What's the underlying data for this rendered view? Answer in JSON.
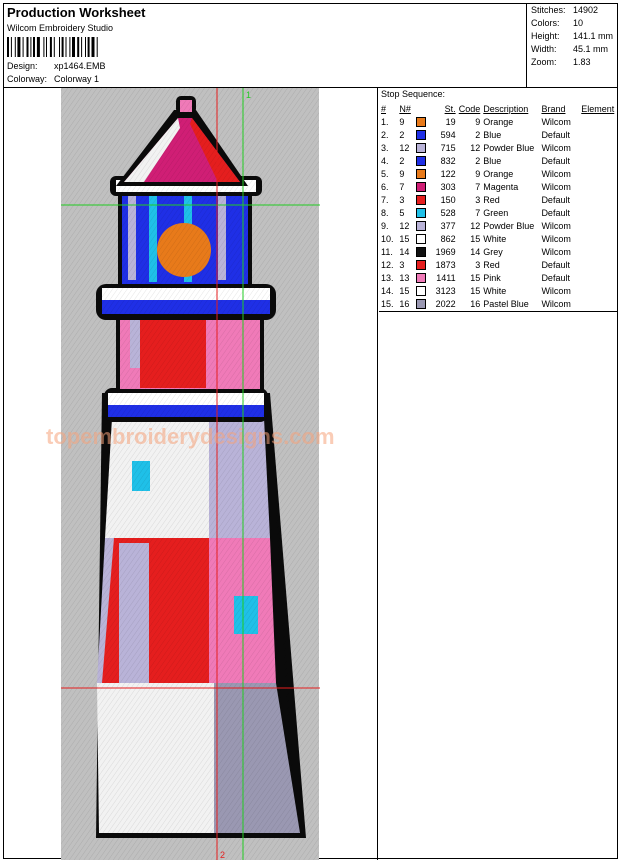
{
  "header": {
    "title": "Production Worksheet",
    "company": "Wilcom Embroidery Studio",
    "design_label": "Design:",
    "design_value": "xp1464.EMB",
    "colorway_label": "Colorway:",
    "colorway_value": "Colorway 1"
  },
  "stats": [
    {
      "label": "Stitches:",
      "value": "14902"
    },
    {
      "label": "Colors:",
      "value": "10"
    },
    {
      "label": "Height:",
      "value": "141.1 mm"
    },
    {
      "label": "Width:",
      "value": "45.1 mm"
    },
    {
      "label": "Zoom:",
      "value": "1.83"
    }
  ],
  "design_preview": {
    "watermark": "topembroiderydesigns.com",
    "marker_1": "1",
    "marker_2": "2"
  },
  "stop_sequence": {
    "title": "Stop Sequence:",
    "columns": [
      "#",
      "N#",
      "St.",
      "Code",
      "Description",
      "Brand",
      "Element"
    ],
    "rows": [
      {
        "idx": "1.",
        "n": "9",
        "st": "19",
        "code": "9",
        "color": "#e87a1a",
        "desc": "Orange",
        "brand": "Wilcom",
        "el": ""
      },
      {
        "idx": "2.",
        "n": "2",
        "st": "594",
        "code": "2",
        "color": "#1f2fe6",
        "desc": "Blue",
        "brand": "Default",
        "el": ""
      },
      {
        "idx": "3.",
        "n": "12",
        "st": "715",
        "code": "12",
        "color": "#b9b3d8",
        "desc": "Powder Blue",
        "brand": "Wilcom",
        "el": ""
      },
      {
        "idx": "4.",
        "n": "2",
        "st": "832",
        "code": "2",
        "color": "#1f2fe6",
        "desc": "Blue",
        "brand": "Default",
        "el": ""
      },
      {
        "idx": "5.",
        "n": "9",
        "st": "122",
        "code": "9",
        "color": "#e87a1a",
        "desc": "Orange",
        "brand": "Wilcom",
        "el": ""
      },
      {
        "idx": "6.",
        "n": "7",
        "st": "303",
        "code": "7",
        "color": "#d01e75",
        "desc": "Magenta",
        "brand": "Wilcom",
        "el": ""
      },
      {
        "idx": "7.",
        "n": "3",
        "st": "150",
        "code": "3",
        "color": "#e51e1e",
        "desc": "Red",
        "brand": "Default",
        "el": ""
      },
      {
        "idx": "8.",
        "n": "5",
        "st": "528",
        "code": "7",
        "color": "#1fc0e8",
        "desc": "Green",
        "brand": "Default",
        "el": ""
      },
      {
        "idx": "9.",
        "n": "12",
        "st": "377",
        "code": "12",
        "color": "#b9b3d8",
        "desc": "Powder Blue",
        "brand": "Wilcom",
        "el": ""
      },
      {
        "idx": "10.",
        "n": "15",
        "st": "862",
        "code": "15",
        "color": "#ffffff",
        "desc": "White",
        "brand": "Wilcom",
        "el": ""
      },
      {
        "idx": "11.",
        "n": "14",
        "st": "1969",
        "code": "14",
        "color": "#111111",
        "desc": "Grey",
        "brand": "Wilcom",
        "el": ""
      },
      {
        "idx": "12.",
        "n": "3",
        "st": "1873",
        "code": "3",
        "color": "#e51e1e",
        "desc": "Red",
        "brand": "Default",
        "el": ""
      },
      {
        "idx": "13.",
        "n": "13",
        "st": "1411",
        "code": "15",
        "color": "#f07ab8",
        "desc": "Pink",
        "brand": "Default",
        "el": ""
      },
      {
        "idx": "14.",
        "n": "15",
        "st": "3123",
        "code": "15",
        "color": "#ffffff",
        "desc": "White",
        "brand": "Wilcom",
        "el": ""
      },
      {
        "idx": "15.",
        "n": "16",
        "st": "2022",
        "code": "16",
        "color": "#9a98b2",
        "desc": "Pastel Blue",
        "brand": "Wilcom",
        "el": ""
      }
    ]
  }
}
